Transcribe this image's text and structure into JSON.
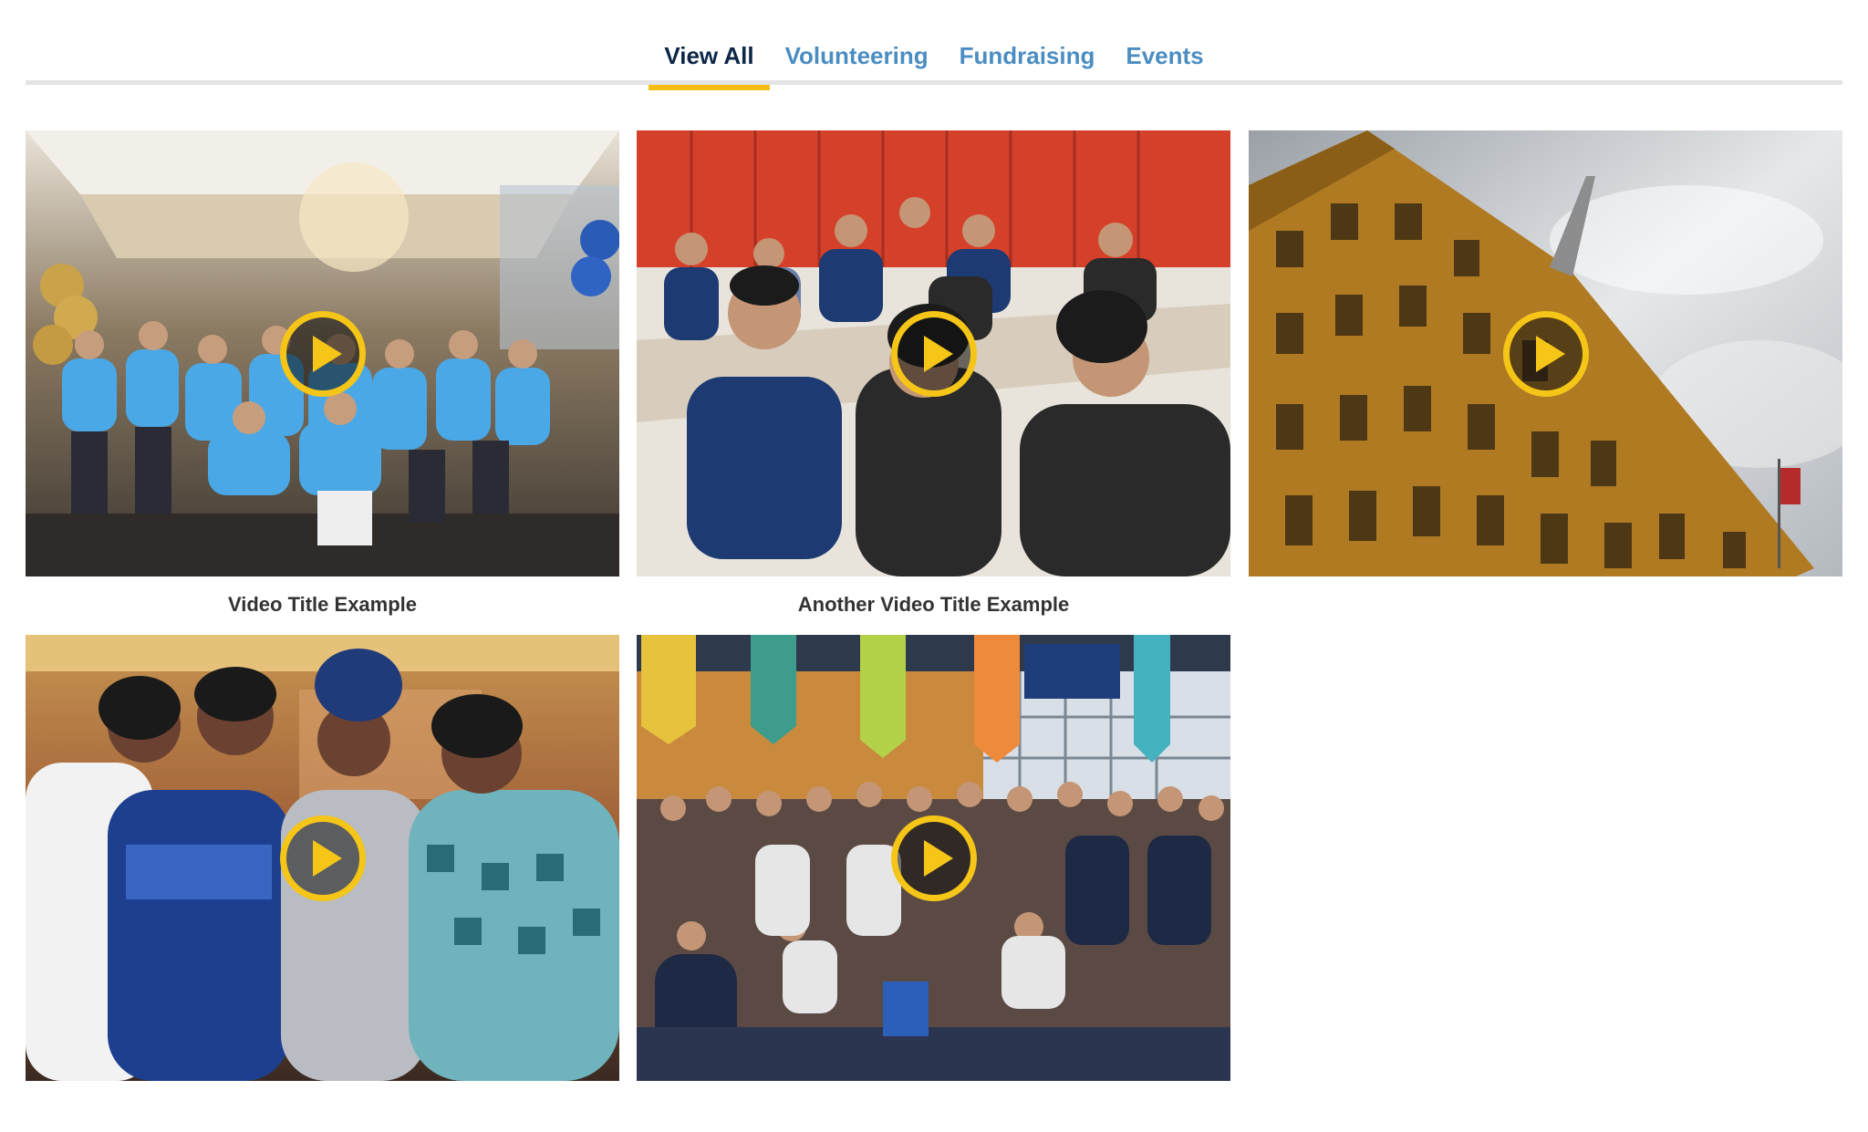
{
  "tabs": [
    {
      "label": "View All",
      "active": true
    },
    {
      "label": "Volunteering",
      "active": false
    },
    {
      "label": "Fundraising",
      "active": false
    },
    {
      "label": "Events",
      "active": false
    }
  ],
  "videos": [
    {
      "title": "Video Title Example",
      "scene": "students in blue t-shirts celebrating"
    },
    {
      "title": "Another Video Title Example",
      "scene": "students seated at desks in classroom"
    },
    {
      "title": "",
      "scene": "brick school building against cloudy sky"
    },
    {
      "title": "",
      "scene": "four women posing at event"
    },
    {
      "title": "",
      "scene": "large group photo in gymnasium with banners"
    }
  ],
  "play_icon": "play-circle-icon",
  "colors": {
    "accent": "#f5bd14",
    "tab_active": "#0d2747",
    "tab_inactive": "#4b8dc2"
  }
}
